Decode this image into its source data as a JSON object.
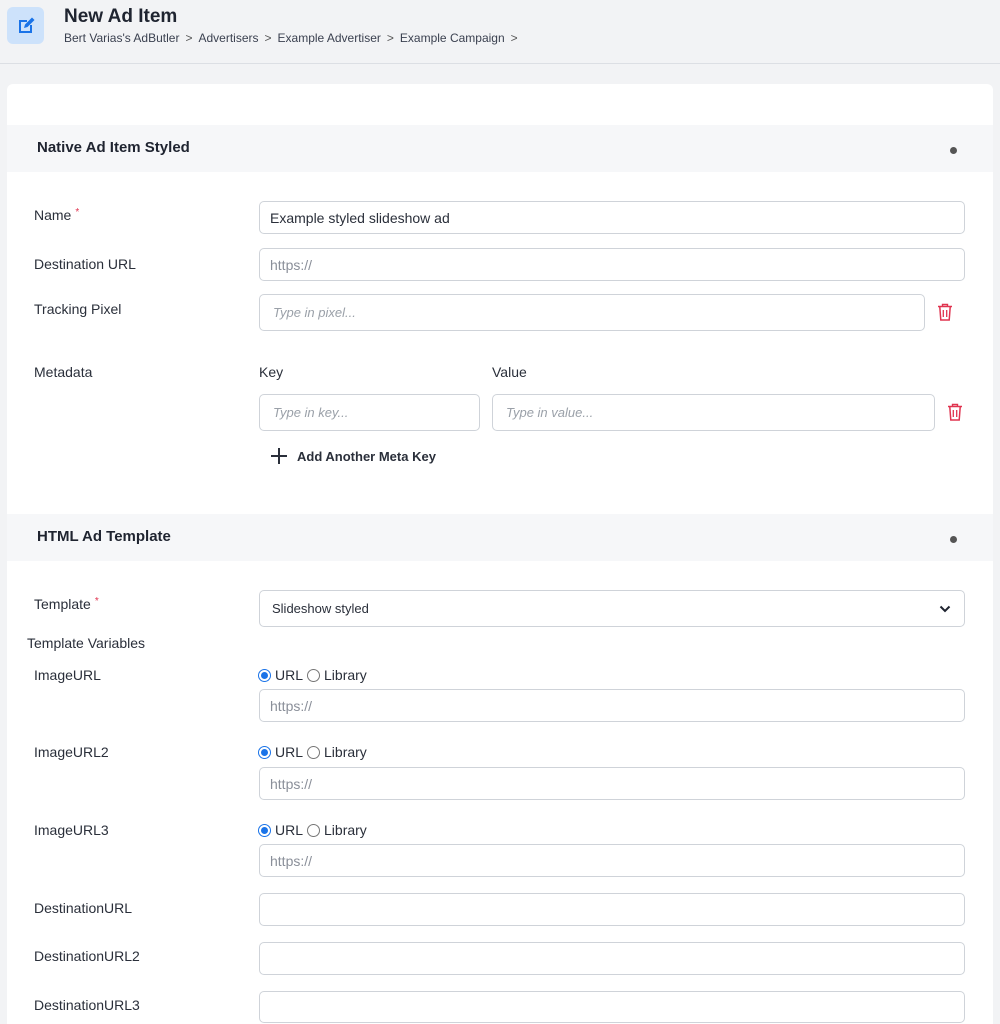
{
  "header": {
    "title": "New Ad Item",
    "breadcrumb": [
      "Bert Varias's AdButler",
      "Advertisers",
      "Example Advertiser",
      "Example Campaign"
    ],
    "separator": ">",
    "icon": "edit-icon"
  },
  "native_section": {
    "title": "Native Ad Item Styled",
    "name_label": "Name",
    "required_mark": "*",
    "name_value": "Example styled slideshow ad",
    "destination_label": "Destination URL",
    "destination_placeholder": "https://",
    "tracking_label": "Tracking Pixel",
    "tracking_placeholder": "Type in pixel...",
    "metadata_label": "Metadata",
    "key_header": "Key",
    "value_header": "Value",
    "key_placeholder": "Type in key...",
    "value_placeholder": "Type in value...",
    "add_meta_label": "Add Another Meta Key"
  },
  "template_section": {
    "title": "HTML Ad Template",
    "template_label": "Template",
    "template_value": "Slideshow styled",
    "template_variables_label": "Template Variables",
    "radio_url": "URL",
    "radio_library": "Library",
    "image_fields": [
      {
        "label": "ImageURL",
        "placeholder": "https://"
      },
      {
        "label": "ImageURL2",
        "placeholder": "https://"
      },
      {
        "label": "ImageURL3",
        "placeholder": "https://"
      }
    ],
    "destination_fields": [
      {
        "label": "DestinationURL",
        "value": ""
      },
      {
        "label": "DestinationURL2",
        "value": ""
      },
      {
        "label": "DestinationURL3",
        "value": ""
      }
    ]
  },
  "colors": {
    "accent": "#1a73e8",
    "danger": "#e0334f",
    "icon_bg": "#cde2fb"
  }
}
